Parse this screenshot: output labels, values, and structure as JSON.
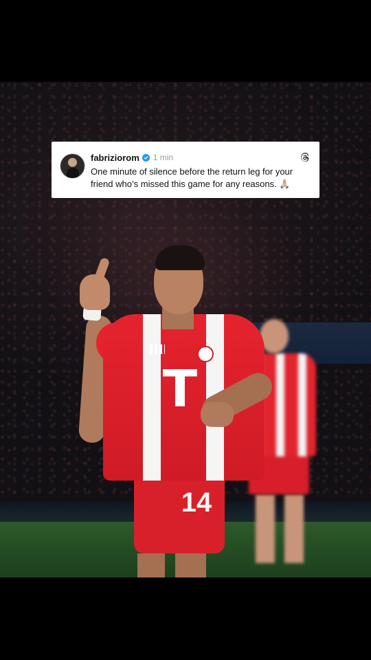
{
  "post": {
    "username": "fabriziorom",
    "verified": true,
    "timestamp": "1 min",
    "text": "One minute of silence before the return leg for your friend who’s missed this game for any reasons. 🙏🏼",
    "avatar_icon": "profile-photo",
    "platform_icon": "threads-icon"
  },
  "photo": {
    "kit_sponsor": "T",
    "shirt_number": "14"
  },
  "colors": {
    "card_bg": "#ffffff",
    "verified_blue": "#1d9bf0",
    "kit_red": "#e5232e",
    "page_bg": "#000000"
  }
}
